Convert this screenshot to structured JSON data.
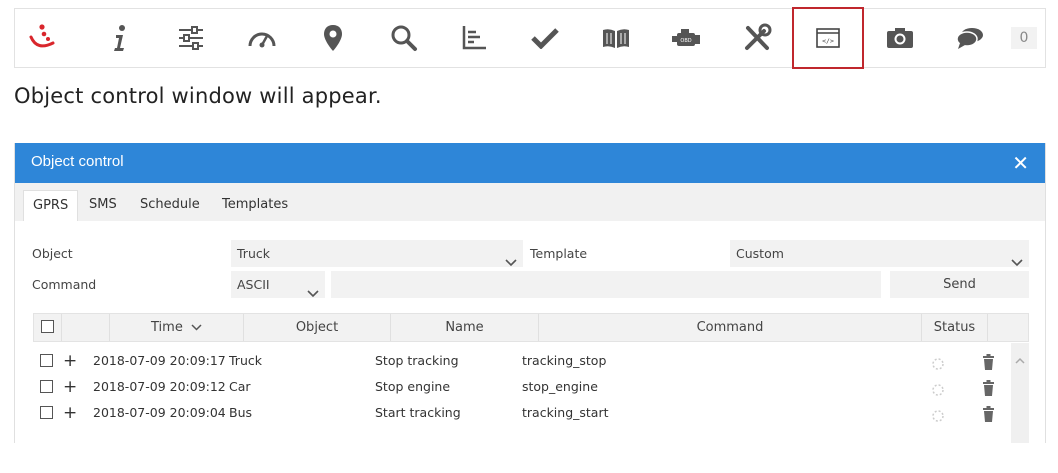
{
  "toolbar": {
    "items": [
      {
        "icon": "logo-icon"
      },
      {
        "icon": "info-icon"
      },
      {
        "icon": "settings-sliders-icon"
      },
      {
        "icon": "speedometer-icon"
      },
      {
        "icon": "map-pin-icon"
      },
      {
        "icon": "search-icon"
      },
      {
        "icon": "chart-icon"
      },
      {
        "icon": "checkmark-icon"
      },
      {
        "icon": "book-icon"
      },
      {
        "icon": "engine-icon"
      },
      {
        "icon": "tools-icon"
      },
      {
        "icon": "object-control-icon",
        "selected": true
      },
      {
        "icon": "camera-icon"
      },
      {
        "icon": "chat-icon"
      }
    ],
    "message_count": "0",
    "selected_outline_color": "#c0272d"
  },
  "caption": "Object control window will appear.",
  "dialog": {
    "title": "Object control",
    "close_label": "✕",
    "header_color": "#2e86d8",
    "tabs": [
      {
        "label": "GPRS",
        "active": true
      },
      {
        "label": "SMS"
      },
      {
        "label": "Schedule"
      },
      {
        "label": "Templates"
      }
    ],
    "form": {
      "object_label": "Object",
      "object_value": "Truck",
      "template_label": "Template",
      "template_value": "Custom",
      "command_label": "Command",
      "command_type": "ASCII",
      "command_value": "",
      "send_label": "Send"
    },
    "grid": {
      "columns": [
        "Time",
        "Object",
        "Name",
        "Command",
        "Status"
      ],
      "sort_indicator": "⌄",
      "rows": [
        {
          "time": "2018-07-09 20:09:17",
          "object": "Truck",
          "name": "Stop tracking",
          "command": "tracking_stop"
        },
        {
          "time": "2018-07-09 20:09:12",
          "object": "Car",
          "name": "Stop engine",
          "command": "stop_engine"
        },
        {
          "time": "2018-07-09 20:09:04",
          "object": "Bus",
          "name": "Start tracking",
          "command": "tracking_start"
        }
      ]
    }
  }
}
